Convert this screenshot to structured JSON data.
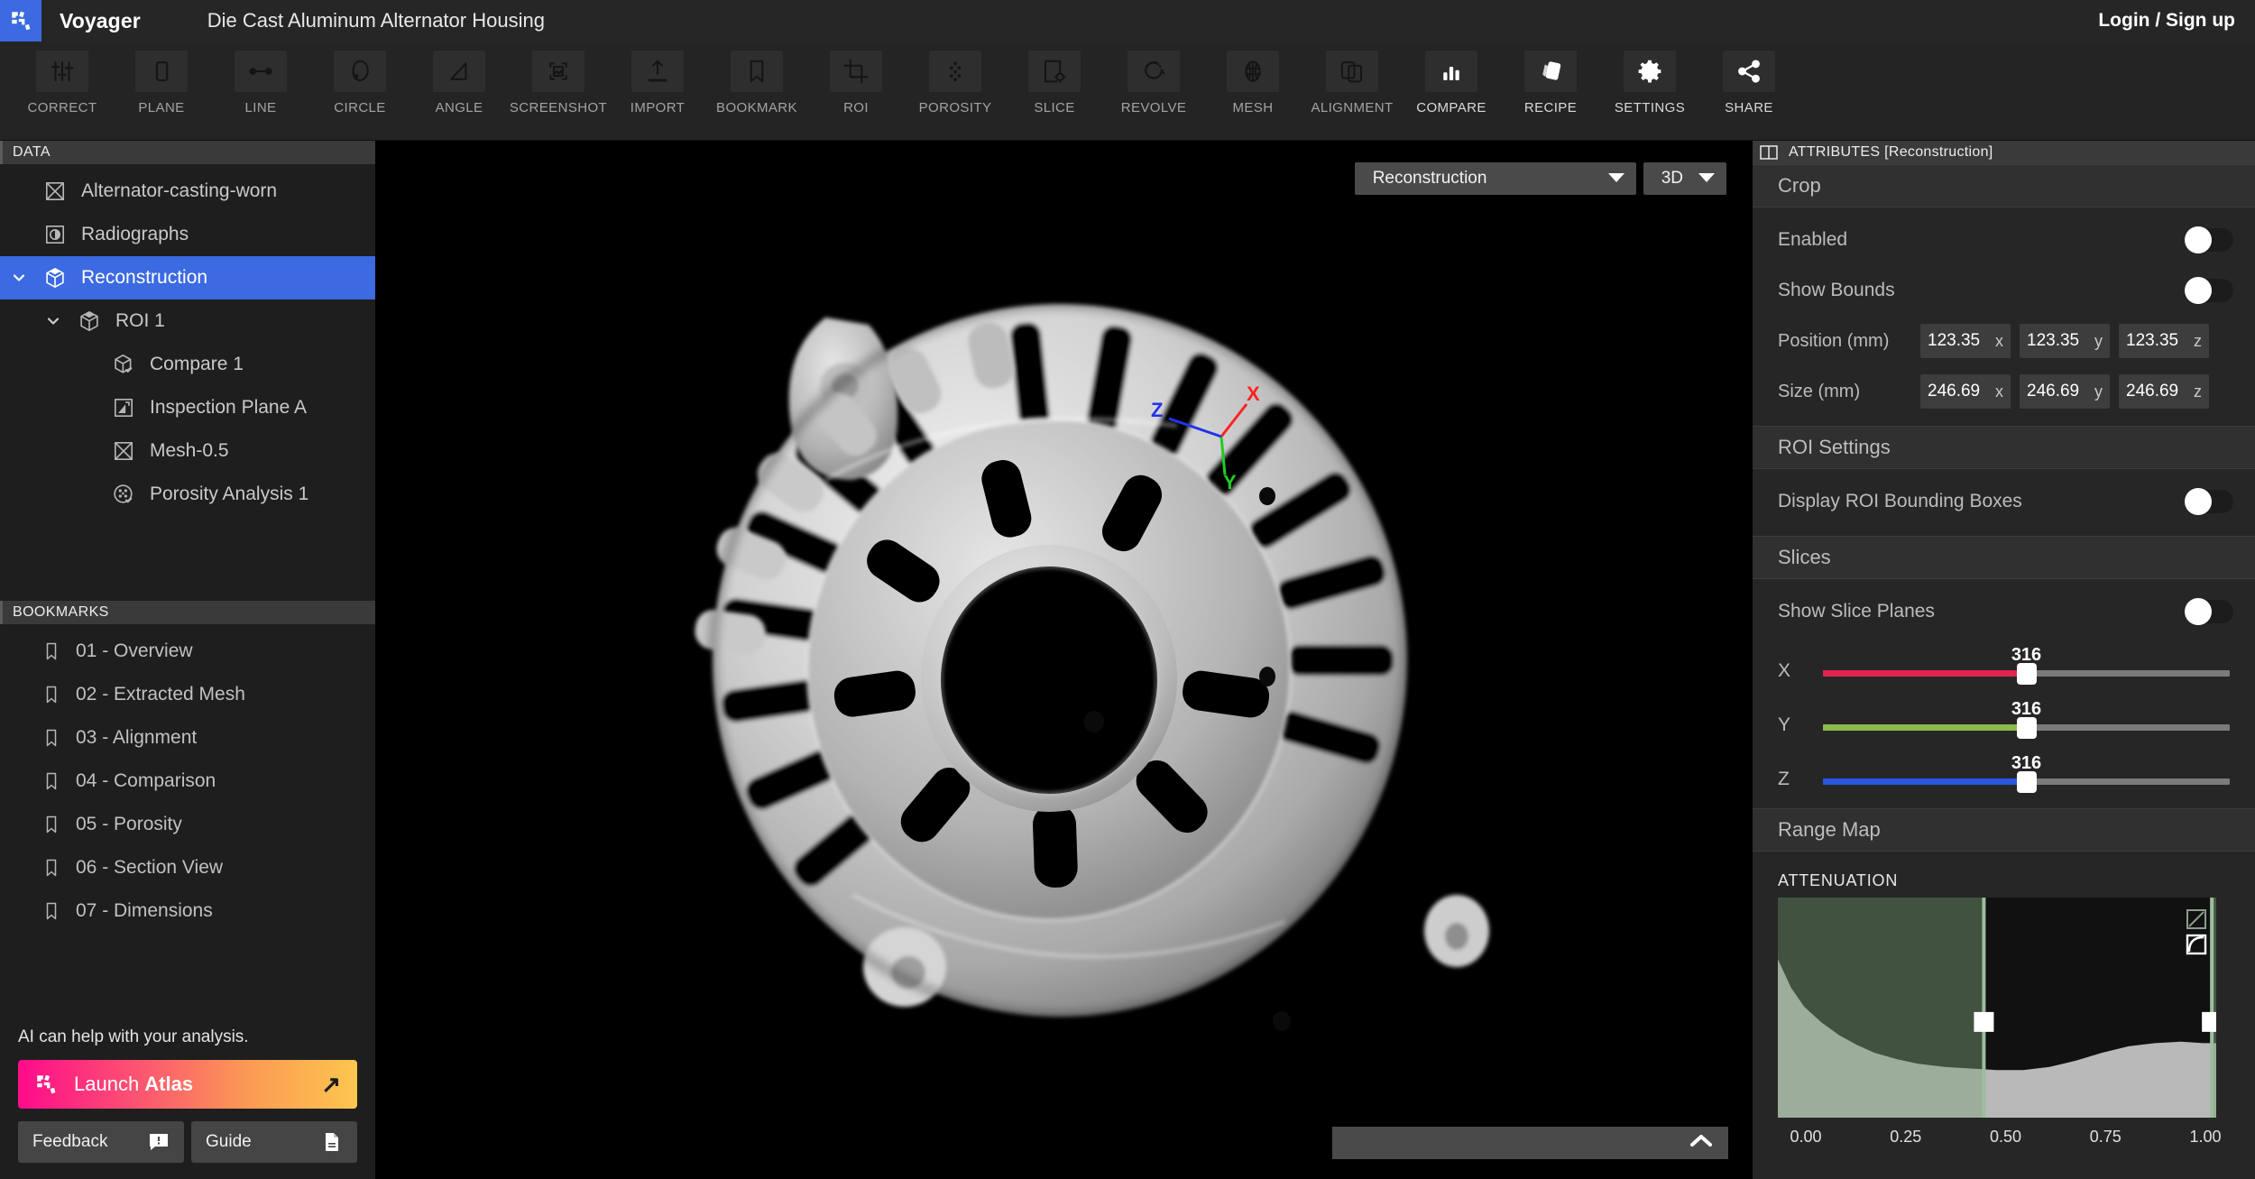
{
  "titlebar": {
    "app_name": "Voyager",
    "doc_title": "Die Cast Aluminum Alternator Housing",
    "login_label": "Login / Sign up",
    "logo_icon": "voyager-logo-icon"
  },
  "toolbar": {
    "items": [
      {
        "label": "CORRECT",
        "icon": "sliders-icon",
        "bright": false
      },
      {
        "label": "PLANE",
        "icon": "rectangle-icon",
        "bright": false
      },
      {
        "label": "LINE",
        "icon": "line-measure-icon",
        "bright": false
      },
      {
        "label": "CIRCLE",
        "icon": "circle-measure-icon",
        "bright": false
      },
      {
        "label": "ANGLE",
        "icon": "angle-icon",
        "bright": false
      },
      {
        "label": "SCREENSHOT",
        "icon": "screenshot-icon",
        "bright": false
      },
      {
        "label": "IMPORT",
        "icon": "upload-icon",
        "bright": false
      },
      {
        "label": "BOOKMARK",
        "icon": "bookmark-icon",
        "bright": false
      },
      {
        "label": "ROI",
        "icon": "crop-icon",
        "bright": false
      },
      {
        "label": "POROSITY",
        "icon": "porosity-dots-icon",
        "bright": false
      },
      {
        "label": "SLICE",
        "icon": "slice-gear-icon",
        "bright": false
      },
      {
        "label": "REVOLVE",
        "icon": "revolve-icon",
        "bright": false
      },
      {
        "label": "MESH",
        "icon": "mesh-icon",
        "bright": false
      },
      {
        "label": "ALIGNMENT",
        "icon": "alignment-icon",
        "bright": false
      },
      {
        "label": "COMPARE",
        "icon": "bar-chart-icon",
        "bright": true
      },
      {
        "label": "RECIPE",
        "icon": "recipe-cards-icon",
        "bright": true
      },
      {
        "label": "SETTINGS",
        "icon": "gear-icon",
        "bright": true
      },
      {
        "label": "SHARE",
        "icon": "share-icon",
        "bright": true
      }
    ]
  },
  "sidebar": {
    "data_header": "DATA",
    "tree": [
      {
        "label": "Alternator-casting-worn",
        "icon": "volume-x-icon",
        "indent": 0,
        "chevron": "none",
        "selected": false
      },
      {
        "label": "Radiographs",
        "icon": "radiograph-icon",
        "indent": 0,
        "chevron": "none",
        "selected": false
      },
      {
        "label": "Reconstruction",
        "icon": "cube-icon",
        "indent": 0,
        "chevron": "down",
        "selected": true
      },
      {
        "label": "ROI 1",
        "icon": "cube-icon",
        "indent": 1,
        "chevron": "down",
        "selected": false
      },
      {
        "label": "Compare 1",
        "icon": "cube-check-icon",
        "indent": 2,
        "chevron": "none",
        "selected": false
      },
      {
        "label": "Inspection Plane A",
        "icon": "plane-icon",
        "indent": 2,
        "chevron": "none",
        "selected": false
      },
      {
        "label": "Mesh-0.5",
        "icon": "volume-x-icon",
        "indent": 2,
        "chevron": "none",
        "selected": false
      },
      {
        "label": "Porosity Analysis 1",
        "icon": "porosity-check-icon",
        "indent": 2,
        "chevron": "none",
        "selected": false
      }
    ],
    "bookmarks_header": "BOOKMARKS",
    "bookmarks": [
      {
        "label": "01 - Overview",
        "icon": "bookmark-icon"
      },
      {
        "label": "02 - Extracted Mesh",
        "icon": "bookmark-icon"
      },
      {
        "label": "03 - Alignment",
        "icon": "bookmark-icon"
      },
      {
        "label": "04 - Comparison",
        "icon": "bookmark-icon"
      },
      {
        "label": "05 - Porosity",
        "icon": "bookmark-icon"
      },
      {
        "label": "06 - Section View",
        "icon": "bookmark-icon"
      },
      {
        "label": "07 - Dimensions",
        "icon": "bookmark-icon"
      }
    ],
    "ai_prompt": "AI can help with your analysis.",
    "atlas_button": {
      "prefix": "Launch ",
      "name": "Atlas",
      "icon": "voyager-logo-icon",
      "arrow_icon": "arrow-up-right-icon"
    },
    "feedback_button": {
      "label": "Feedback",
      "icon": "feedback-bubble-icon"
    },
    "guide_button": {
      "label": "Guide",
      "icon": "document-icon"
    }
  },
  "viewport": {
    "dataset_select": {
      "value": "Reconstruction",
      "caret_icon": "chevron-down-icon"
    },
    "mode_select": {
      "value": "3D",
      "caret_icon": "chevron-down-icon"
    },
    "gizmo": {
      "x_label": "X",
      "y_label": "Y",
      "z_label": "Z",
      "x_color": "#ff2222",
      "y_color": "#22cc22",
      "z_color": "#2233ee"
    },
    "bottom_bar": {
      "expand_icon": "chevron-up-icon"
    },
    "render_alt": "ct-volume-render-alternator-housing"
  },
  "attributes": {
    "panel_title": "ATTRIBUTES [Reconstruction]",
    "split_icon": "panel-split-icon",
    "crop": {
      "title": "Crop",
      "enabled": {
        "label": "Enabled",
        "on": false
      },
      "show_bounds": {
        "label": "Show Bounds",
        "on": false
      },
      "position": {
        "label": "Position (mm)",
        "x": "123.35",
        "y": "123.35",
        "z": "123.35",
        "ax_x": "x",
        "ax_y": "y",
        "ax_z": "z"
      },
      "size": {
        "label": "Size (mm)",
        "x": "246.69",
        "y": "246.69",
        "z": "246.69",
        "ax_x": "x",
        "ax_y": "y",
        "ax_z": "z"
      }
    },
    "roi_settings": {
      "title": "ROI Settings",
      "display_boxes": {
        "label": "Display ROI Bounding Boxes",
        "on": false
      }
    },
    "slices": {
      "title": "Slices",
      "show_planes": {
        "label": "Show Slice Planes",
        "on": false
      },
      "sliders": [
        {
          "axis": "X",
          "value": "316",
          "percent": 50,
          "color": "#e0244f"
        },
        {
          "axis": "Y",
          "value": "316",
          "percent": 50,
          "color": "#8eba4e"
        },
        {
          "axis": "Z",
          "value": "316",
          "percent": 50,
          "color": "#2b55e0"
        }
      ]
    },
    "range_map": {
      "title": "Range Map",
      "histogram_label": "ATTENUATION",
      "ticks": [
        "0.00",
        "0.25",
        "0.50",
        "0.75",
        "1.00"
      ],
      "handle_low_percent": 47,
      "handle_high_percent": 99
    }
  },
  "chart_data": {
    "type": "area",
    "title": "ATTENUATION",
    "xlabel": "",
    "ylabel": "",
    "xlim": [
      0.0,
      1.0
    ],
    "tick_labels": [
      "0.00",
      "0.25",
      "0.50",
      "0.75",
      "1.00"
    ],
    "grid": false,
    "legend": "none",
    "selection_low": 0.47,
    "selection_high": 0.99,
    "series": [
      {
        "name": "attenuation histogram",
        "x": [
          0.0,
          0.03,
          0.06,
          0.1,
          0.14,
          0.18,
          0.22,
          0.27,
          0.32,
          0.38,
          0.44,
          0.5,
          0.56,
          0.62,
          0.68,
          0.74,
          0.8,
          0.86,
          0.92,
          0.97,
          1.0
        ],
        "values": [
          1.0,
          0.82,
          0.7,
          0.6,
          0.52,
          0.46,
          0.41,
          0.37,
          0.34,
          0.32,
          0.31,
          0.3,
          0.3,
          0.32,
          0.36,
          0.41,
          0.45,
          0.47,
          0.48,
          0.47,
          0.47
        ]
      }
    ]
  }
}
